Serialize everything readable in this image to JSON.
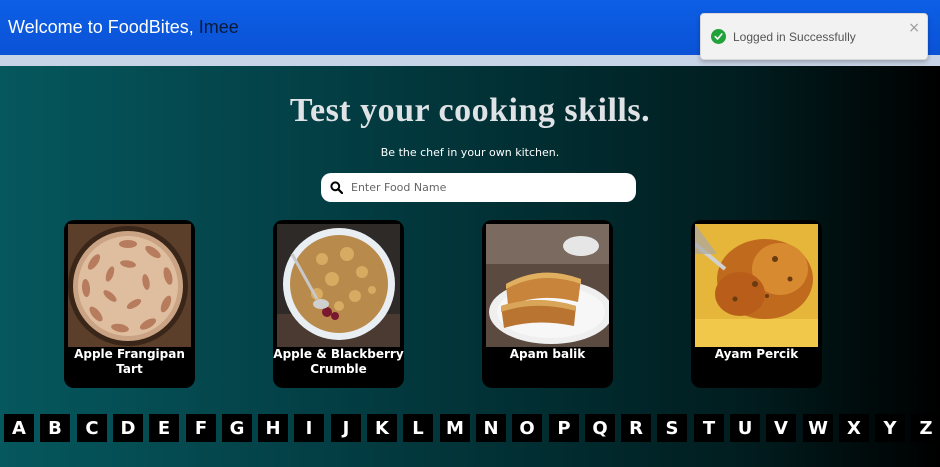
{
  "header": {
    "welcome_text": "Welcome to FoodBites,",
    "username": "Imee"
  },
  "toast": {
    "message": "Logged in Successfully",
    "close_glyph": "×",
    "icon": "check-circle-icon"
  },
  "hero": {
    "title": "Test your cooking skills.",
    "subtitle": "Be the chef in your own kitchen."
  },
  "search": {
    "placeholder": "Enter Food Name",
    "value": "",
    "icon": "search-icon"
  },
  "recipes": [
    {
      "name": "Apple Frangipan Tart"
    },
    {
      "name": "Apple & Blackberry Crumble"
    },
    {
      "name": "Apam balik"
    },
    {
      "name": "Ayam Percik"
    }
  ],
  "alphabet": [
    "A",
    "B",
    "C",
    "D",
    "E",
    "F",
    "G",
    "H",
    "I",
    "J",
    "K",
    "L",
    "M",
    "N",
    "O",
    "P",
    "Q",
    "R",
    "S",
    "T",
    "U",
    "V",
    "W",
    "X",
    "Y",
    "Z"
  ],
  "colors": {
    "header_blue": "#0a52d6",
    "success_green": "#22a23a",
    "card_black": "#000000",
    "bg_teal": "#05585e"
  }
}
